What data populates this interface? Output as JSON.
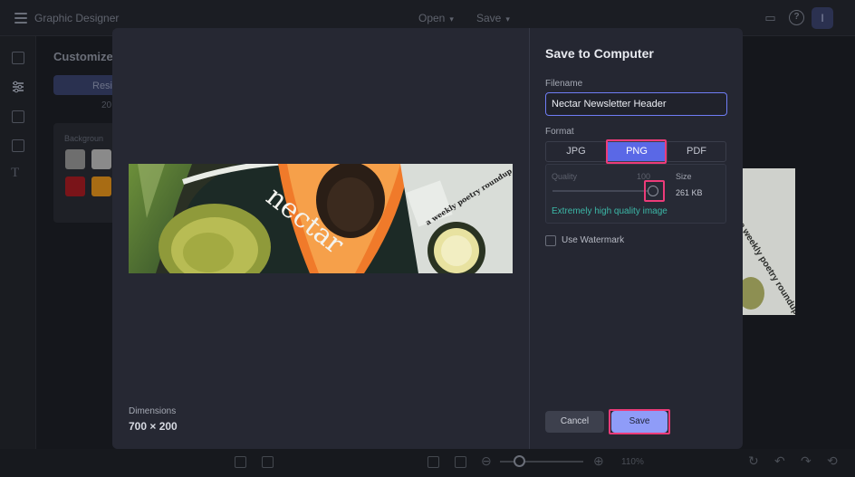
{
  "app": {
    "title": "Graphic Designer",
    "menu": [
      {
        "label": "Open",
        "icon": "chevron-down-icon"
      },
      {
        "label": "Save",
        "icon": "chevron-down-icon"
      }
    ],
    "avatar_initial": "I"
  },
  "side_panel": {
    "title": "Customize",
    "tab_label": "Resi",
    "number_hint": "20",
    "background_label": "Backgroun",
    "swatch_colors": [
      "#6e6e6e",
      "#8a8a8a",
      "#7a1419",
      "#a86c14"
    ]
  },
  "bottom_bar": {
    "zoom": "110%"
  },
  "dialog": {
    "title": "Save to Computer",
    "filename_label": "Filename",
    "filename_value": "Nectar Newsletter Header",
    "format_label": "Format",
    "formats": [
      "JPG",
      "PNG",
      "PDF"
    ],
    "selected_format": "PNG",
    "quality_label": "Quality",
    "quality_value": "100",
    "quality_fraction": 1.0,
    "size_label": "Size",
    "size_value": "261 KB",
    "quality_description": "Extremely high quality image",
    "watermark_label": "Use Watermark",
    "watermark_checked": false,
    "cancel_label": "Cancel",
    "save_label": "Save"
  },
  "preview": {
    "brand_text": "nectar",
    "tagline": "a weekly poetry roundup",
    "dimensions_label": "Dimensions",
    "dimensions_value": "700 × 200"
  },
  "colors": {
    "accent": "#5a68e6",
    "save_button": "#8f9cf8",
    "highlight": "#ec3b79",
    "quality_text": "#3cb8a8"
  }
}
